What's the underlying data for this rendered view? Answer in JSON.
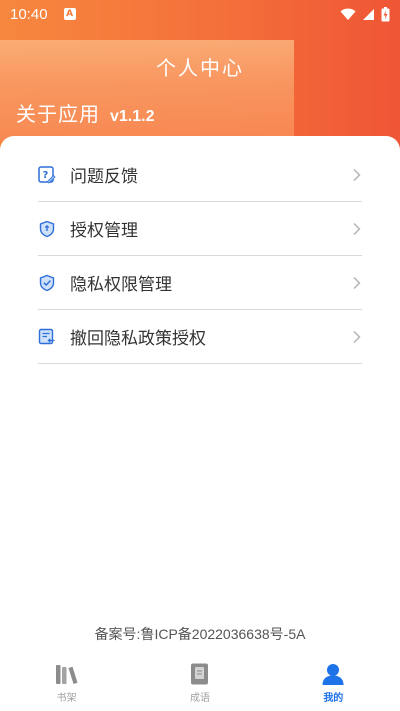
{
  "status": {
    "time": "10:40",
    "notif_badge": "A"
  },
  "header": {
    "title": "个人中心",
    "about_label": "关于应用",
    "version": "v1.1.2"
  },
  "menu": {
    "items": [
      {
        "label": "问题反馈",
        "icon": "feedback-icon"
      },
      {
        "label": "授权管理",
        "icon": "shield-icon"
      },
      {
        "label": "隐私权限管理",
        "icon": "shield-check-icon"
      },
      {
        "label": "撤回隐私政策授权",
        "icon": "revoke-icon"
      }
    ]
  },
  "footer": {
    "icp": "备案号:鲁ICP备2022036638号-5A"
  },
  "tabs": [
    {
      "label": "书架",
      "icon": "books-icon",
      "active": false
    },
    {
      "label": "成语",
      "icon": "idiom-book-icon",
      "active": false
    },
    {
      "label": "我的",
      "icon": "person-icon",
      "active": true
    }
  ],
  "colors": {
    "accent": "#1f73e8",
    "header_start": "#f7873f",
    "header_end": "#ef5536"
  }
}
